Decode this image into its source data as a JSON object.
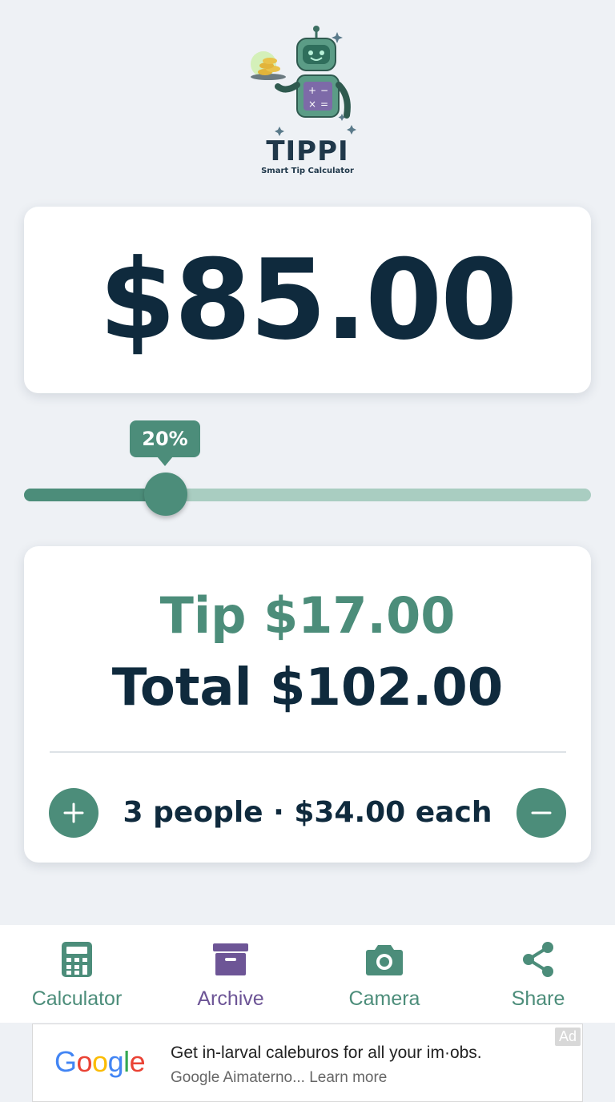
{
  "app": {
    "name": "TIPPI",
    "tagline": "Smart Tip Calculator"
  },
  "bill": {
    "amount": "$85.00"
  },
  "tip_slider": {
    "label": "20%",
    "value_fraction": 0.25
  },
  "result": {
    "tip": "Tip $17.00",
    "total": "Total $102.00",
    "split": "3 people · $34.00 each"
  },
  "nav": {
    "items": [
      {
        "label": "Calculator",
        "icon": "calculator-icon",
        "color": "#4c8d7a"
      },
      {
        "label": "Archive",
        "icon": "archive-icon",
        "color": "#6d5596"
      },
      {
        "label": "Camera",
        "icon": "camera-icon",
        "color": "#4c8d7a"
      },
      {
        "label": "Share",
        "icon": "share-icon",
        "color": "#4c8d7a"
      }
    ]
  },
  "ad": {
    "tag": "Ad",
    "brand": "Google",
    "headline": "Get in-larval caleburos for all your im·obs.",
    "subline": "Google Aimaterno... Learn more"
  },
  "colors": {
    "accent": "#4c8d7a",
    "dark": "#0f2a3d",
    "archive": "#6d5596"
  }
}
